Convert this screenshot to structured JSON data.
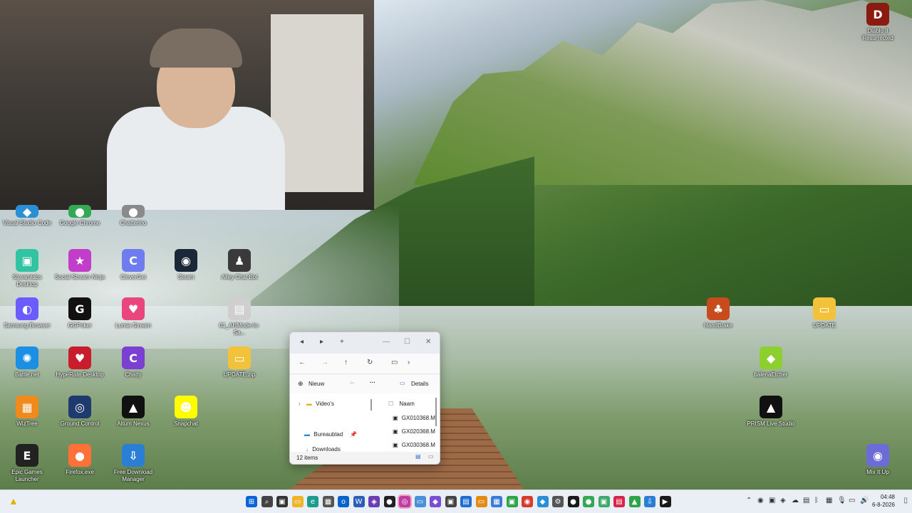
{
  "desktop_icons": [
    {
      "label": "Visual Studio Code",
      "icon": "vscode-icon",
      "color": "#2b8fd6",
      "glyph": "◆"
    },
    {
      "label": "Google Chrome",
      "icon": "chrome-icon",
      "color": "#34a853",
      "glyph": "●"
    },
    {
      "label": "Chatterino",
      "icon": "chatterino-icon",
      "color": "#8a8a8a",
      "glyph": "●"
    },
    {
      "label": "Streamlabs Desktop",
      "icon": "streamlabs-icon",
      "color": "#31c3a2",
      "glyph": "▣"
    },
    {
      "label": "Social Stream Ninja",
      "icon": "social-stream-ninja-icon",
      "color": "#c23dc9",
      "glyph": "★"
    },
    {
      "label": "CleverGet",
      "icon": "cleverget-icon",
      "color": "#6f7cf0",
      "glyph": "C"
    },
    {
      "label": "Steam",
      "icon": "steam-icon",
      "color": "#1b2838",
      "glyph": "◉"
    },
    {
      "label": "Alley Chat Bot",
      "icon": "alley-chat-bot-icon",
      "color": "#3a3a3a",
      "glyph": "♟"
    },
    {
      "label": "Samsung Browser",
      "icon": "samsung-browser-icon",
      "color": "#6a5cff",
      "glyph": "◐"
    },
    {
      "label": "GGPoker",
      "icon": "ggpoker-icon",
      "color": "#111111",
      "glyph": "G"
    },
    {
      "label": "Lumia Stream",
      "icon": "lumia-stream-icon",
      "color": "#e8467c",
      "glyph": "♥"
    },
    {
      "label": "01_AHMode-In-Sa...",
      "icon": "video-file-icon",
      "color": "#cfcfcf",
      "glyph": "▤"
    },
    {
      "label": "Battle.net",
      "icon": "battlenet-icon",
      "color": "#1a8fe3",
      "glyph": "✺"
    },
    {
      "label": "HypeRate Desktop",
      "icon": "hyperate-icon",
      "color": "#c91d2c",
      "glyph": "♥"
    },
    {
      "label": "Chatty",
      "icon": "chatty-icon",
      "color": "#7b3fd1",
      "glyph": "C"
    },
    {
      "label": "UPDATE.zip",
      "icon": "zip-folder-icon",
      "color": "#f2c33a",
      "glyph": "▭"
    },
    {
      "label": "WizTree",
      "icon": "wiztree-icon",
      "color": "#f08a1c",
      "glyph": "▦"
    },
    {
      "label": "Ground Control",
      "icon": "ground-control-icon",
      "color": "#1f3a6e",
      "glyph": "◎"
    },
    {
      "label": "Altum Nexus",
      "icon": "altum-nexus-icon",
      "color": "#111111",
      "glyph": "▲"
    },
    {
      "label": "Snapchat",
      "icon": "snapchat-icon",
      "color": "#fffc00",
      "glyph": "☻"
    },
    {
      "label": "Epic Games Launcher",
      "icon": "epic-games-icon",
      "color": "#222222",
      "glyph": "E"
    },
    {
      "label": "Firefox.exe",
      "icon": "firefox-icon",
      "color": "#ff7139",
      "glyph": "●"
    },
    {
      "label": "Free Download Manager",
      "icon": "fdm-icon",
      "color": "#2a7fd4",
      "glyph": "⇩"
    }
  ],
  "right_icons": [
    {
      "label": "Diablo II Resurrected",
      "icon": "diablo-icon",
      "color": "#8b1a10",
      "glyph": "D"
    },
    {
      "label": "HandBrake",
      "icon": "handbrake-icon",
      "color": "#c84b1e",
      "glyph": "♣"
    },
    {
      "label": "UPDATE",
      "icon": "folder-icon",
      "color": "#f2c33a",
      "glyph": "▭"
    },
    {
      "label": "balenaEtcher",
      "icon": "balena-etcher-icon",
      "color": "#8ccf2f",
      "glyph": "◆"
    },
    {
      "label": "PRISM Live Studio",
      "icon": "prism-icon",
      "color": "#111111",
      "glyph": "▲"
    },
    {
      "label": "Mix It Up",
      "icon": "mix-it-up-icon",
      "color": "#6c6cd8",
      "glyph": "◉"
    }
  ],
  "explorer": {
    "new_label": "Nieuw",
    "details_label": "Details",
    "nav_items": [
      "Video's",
      "Bureaublad",
      "Downloads"
    ],
    "column_header": "Naam",
    "files": [
      "GX010368.M",
      "GX020368.M",
      "GX030368.M"
    ],
    "status": "12 items"
  },
  "clock": {
    "time": "04:48",
    "date": "6-8-2026"
  },
  "taskbar_apps": [
    {
      "icon": "start-icon",
      "color": "#0a64d8",
      "glyph": "⊞"
    },
    {
      "icon": "search-icon",
      "color": "#444444",
      "glyph": "⌕"
    },
    {
      "icon": "task-view-icon",
      "color": "#333333",
      "glyph": "▣"
    },
    {
      "icon": "file-explorer-icon",
      "color": "#f0b429",
      "glyph": "▭"
    },
    {
      "icon": "edge-icon",
      "color": "#1c9b8e",
      "glyph": "e"
    },
    {
      "icon": "app-icon",
      "color": "#555555",
      "glyph": "▦"
    },
    {
      "icon": "outlook-icon",
      "color": "#0a64c8",
      "glyph": "o"
    },
    {
      "icon": "word-icon",
      "color": "#2b5fb8",
      "glyph": "W"
    },
    {
      "icon": "app-icon",
      "color": "#6a3fb3",
      "glyph": "◈"
    },
    {
      "icon": "app-icon",
      "color": "#222222",
      "glyph": "●"
    },
    {
      "icon": "copilot-icon",
      "color": "#c03da0",
      "glyph": "◎"
    },
    {
      "icon": "app-icon",
      "color": "#4a90d9",
      "glyph": "▭"
    },
    {
      "icon": "app-icon",
      "color": "#7a4fd1",
      "glyph": "◆"
    },
    {
      "icon": "app-icon",
      "color": "#444444",
      "glyph": "▣"
    },
    {
      "icon": "app-icon",
      "color": "#1f6fd1",
      "glyph": "▤"
    },
    {
      "icon": "app-icon",
      "color": "#e38b17",
      "glyph": "▭"
    },
    {
      "icon": "app-icon",
      "color": "#3a7bd5",
      "glyph": "▦"
    },
    {
      "icon": "app-icon",
      "color": "#2fa34a",
      "glyph": "▣"
    },
    {
      "icon": "app-icon",
      "color": "#d83a2e",
      "glyph": "◉"
    },
    {
      "icon": "vscode-icon",
      "color": "#2b8fd6",
      "glyph": "◆"
    },
    {
      "icon": "app-icon",
      "color": "#555555",
      "glyph": "⚙"
    },
    {
      "icon": "app-icon",
      "color": "#1a1a1a",
      "glyph": "●"
    },
    {
      "icon": "chrome-icon",
      "color": "#34a853",
      "glyph": "●"
    },
    {
      "icon": "app-icon",
      "color": "#3fa86a",
      "glyph": "▣"
    },
    {
      "icon": "app-icon",
      "color": "#d8234a",
      "glyph": "▤"
    },
    {
      "icon": "app-icon",
      "color": "#2fa34a",
      "glyph": "▲"
    },
    {
      "icon": "app-icon",
      "color": "#2a7fd4",
      "glyph": "⇩"
    },
    {
      "icon": "app-icon",
      "color": "#1a1a1a",
      "glyph": "▶"
    }
  ],
  "tray_icons": [
    "chevron-up-icon",
    "steam-tray-icon",
    "app-tray-icon",
    "shield-tray-icon",
    "cloud-tray-icon",
    "app-tray-icon",
    "bluetooth-icon",
    "app-tray-icon",
    "microphone-icon",
    "network-icon",
    "volume-icon"
  ]
}
